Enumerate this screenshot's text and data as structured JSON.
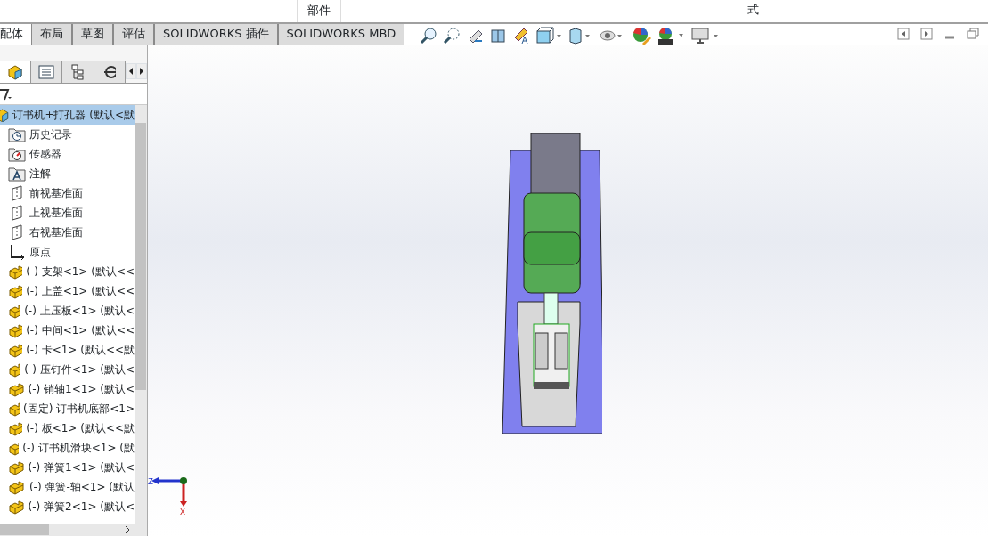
{
  "ribbon": {
    "labels": [
      "部件",
      "式"
    ]
  },
  "tabs": [
    {
      "label": "配体",
      "selected": true
    },
    {
      "label": "布局",
      "selected": false
    },
    {
      "label": "草图",
      "selected": false
    },
    {
      "label": "评估",
      "selected": false
    },
    {
      "label": "SOLIDWORKS 插件",
      "selected": false
    },
    {
      "label": "SOLIDWORKS MBD",
      "selected": false
    }
  ],
  "tree": {
    "label": "订书机+打孔器 (默认<默",
    "selected": true,
    "children": [
      {
        "kind": "history",
        "label": "历史记录"
      },
      {
        "kind": "sensor",
        "label": "传感器"
      },
      {
        "kind": "annotation",
        "label": "注解"
      },
      {
        "kind": "plane",
        "label": "前视基准面"
      },
      {
        "kind": "plane",
        "label": "上视基准面"
      },
      {
        "kind": "plane",
        "label": "右视基准面"
      },
      {
        "kind": "origin",
        "label": "原点"
      },
      {
        "kind": "part",
        "label": "(-) 支架<1> (默认<<"
      },
      {
        "kind": "part",
        "label": "(-) 上盖<1> (默认<<"
      },
      {
        "kind": "part",
        "label": "(-) 上压板<1> (默认<"
      },
      {
        "kind": "part",
        "label": "(-) 中间<1> (默认<<"
      },
      {
        "kind": "part",
        "label": "(-) 卡<1> (默认<<默"
      },
      {
        "kind": "part",
        "label": "(-) 压钉件<1> (默认<"
      },
      {
        "kind": "part",
        "label": "(-) 销轴1<1> (默认<"
      },
      {
        "kind": "part",
        "label": "(固定) 订书机底部<1>"
      },
      {
        "kind": "part",
        "label": "(-) 板<1> (默认<<默"
      },
      {
        "kind": "part",
        "label": "(-) 订书机滑块<1> (默"
      },
      {
        "kind": "part",
        "label": "(-) 弹簧1<1> (默认<"
      },
      {
        "kind": "part",
        "label": "(-) 弹簧-轴<1> (默认"
      },
      {
        "kind": "part",
        "label": "(-) 弹簧2<1> (默认<"
      }
    ]
  },
  "triad": {
    "horizontal": "Z",
    "vertical": "X"
  }
}
